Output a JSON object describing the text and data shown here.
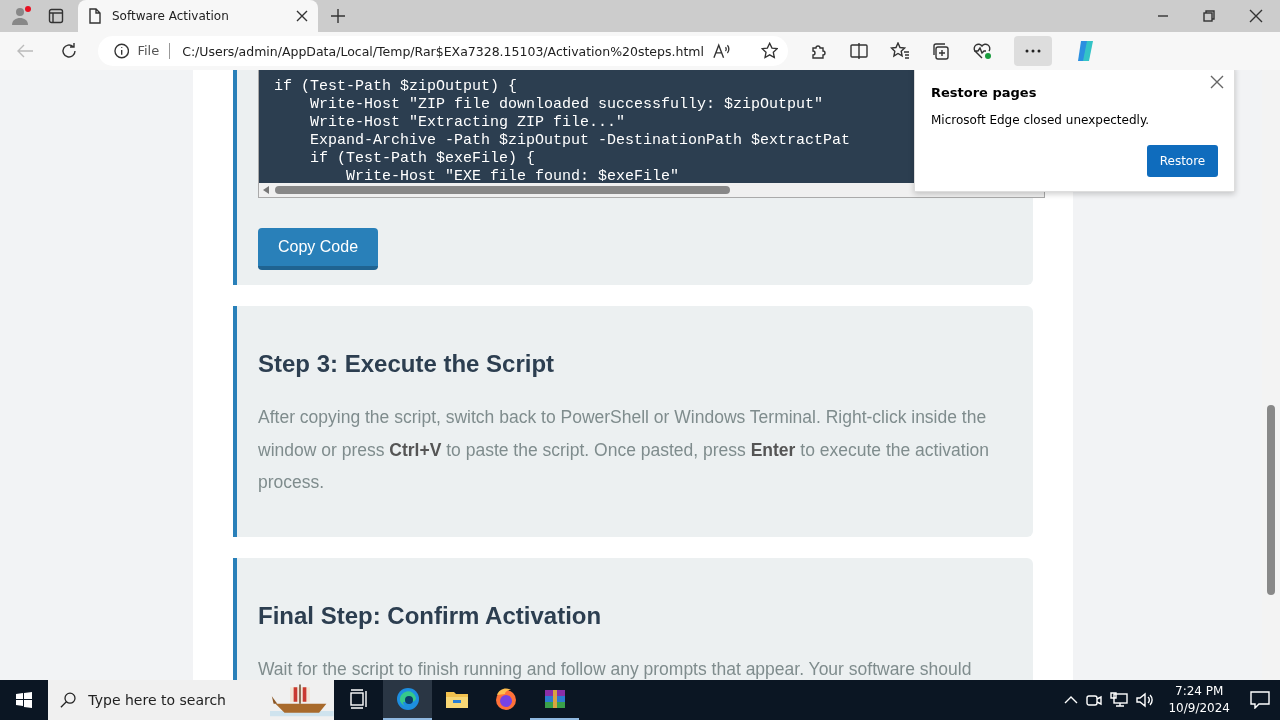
{
  "browser": {
    "tab": {
      "title": "Software Activation"
    },
    "address": {
      "scheme": "File",
      "url": "C:/Users/admin/AppData/Local/Temp/Rar$EXa7328.15103/Activation%20steps.html"
    }
  },
  "page": {
    "code_card": {
      "code_lines": [
        "if (Test-Path $zipOutput) {",
        "    Write-Host \"ZIP file downloaded successfully: $zipOutput\"",
        "    Write-Host \"Extracting ZIP file...\"",
        "    Expand-Archive -Path $zipOutput -DestinationPath $extractPat",
        "    if (Test-Path $exeFile) {",
        "        Write-Host \"EXE file found: $exeFile\""
      ],
      "button": "Copy Code"
    },
    "steps": [
      {
        "heading": "Step 3: Execute the Script",
        "text": "After copying the script, switch back to PowerShell or Windows Terminal. Right-click inside the window or press **Ctrl+V** to paste the script. Once pasted, press **Enter** to execute the activation process."
      },
      {
        "heading": "Final Step: Confirm Activation",
        "text": "Wait for the script to finish running and follow any prompts that appear. Your software should"
      }
    ]
  },
  "popup": {
    "title": "Restore pages",
    "message": "Microsoft Edge closed unexpectedly.",
    "button": "Restore"
  },
  "taskbar": {
    "search_placeholder": "Type here to search",
    "apps": [
      {
        "kind": "taskview",
        "active": false,
        "running": false
      },
      {
        "kind": "edge",
        "active": true,
        "running": true
      },
      {
        "kind": "explorer",
        "active": false,
        "running": false
      },
      {
        "kind": "firefox",
        "active": false,
        "running": false
      },
      {
        "kind": "archive",
        "active": false,
        "running": true
      }
    ],
    "time": "7:24 PM",
    "date": "10/9/2024"
  }
}
